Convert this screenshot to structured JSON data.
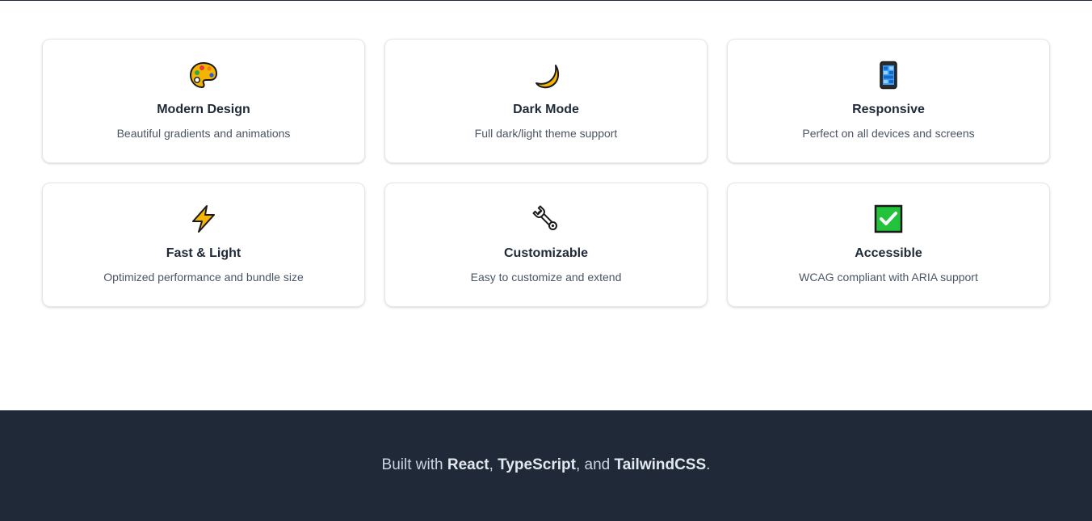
{
  "features": [
    {
      "icon": "palette-icon",
      "title": "Modern Design",
      "description": "Beautiful gradients and animations"
    },
    {
      "icon": "crescent-moon-icon",
      "title": "Dark Mode",
      "description": "Full dark/light theme support"
    },
    {
      "icon": "mobile-phone-icon",
      "title": "Responsive",
      "description": "Perfect on all devices and screens"
    },
    {
      "icon": "lightning-icon",
      "title": "Fast & Light",
      "description": "Optimized performance and bundle size"
    },
    {
      "icon": "wrench-icon",
      "title": "Customizable",
      "description": "Easy to customize and extend"
    },
    {
      "icon": "check-mark-button-icon",
      "title": "Accessible",
      "description": "WCAG compliant with ARIA support"
    }
  ],
  "footer": {
    "prefix": "Built with ",
    "tech1": "React",
    "sep1": ", ",
    "tech2": "TypeScript",
    "sep2": ", and ",
    "tech3": "TailwindCSS",
    "suffix": "."
  },
  "colors": {
    "footer_bg": "#1f2937",
    "card_border": "#e5e7eb",
    "title": "#1f2937",
    "description": "#4b5563"
  }
}
